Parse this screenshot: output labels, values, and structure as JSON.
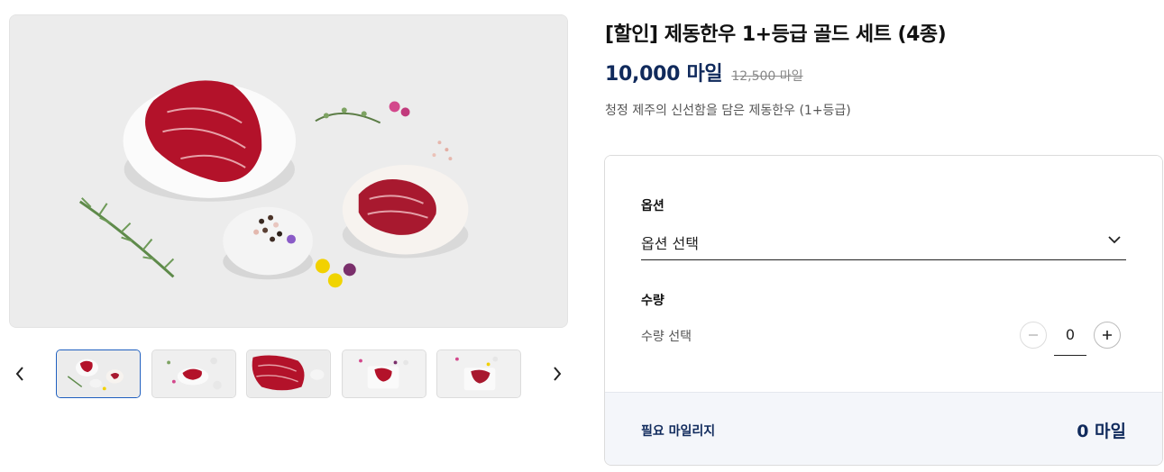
{
  "product": {
    "title": "[할인] 제동한우 1+등급 골드 세트 (4종)",
    "price": "10,000 마일",
    "original_price": "12,500 마일",
    "description": "청정 제주의 신선함을 담은 제동한우 (1+등급)"
  },
  "gallery": {
    "thumbnail_count": 5,
    "active_index": 0
  },
  "options": {
    "option_label": "옵션",
    "option_select_value": "옵션 선택",
    "quantity_label": "수량",
    "quantity_sub_label": "수량 선택",
    "quantity_value": "0"
  },
  "footer": {
    "required_label": "필요 마일리지",
    "required_value": "0 마일"
  },
  "colors": {
    "accent_navy": "#102a5c",
    "active_thumb_border": "#1f5fbf",
    "meat_red": "#b3122a"
  }
}
